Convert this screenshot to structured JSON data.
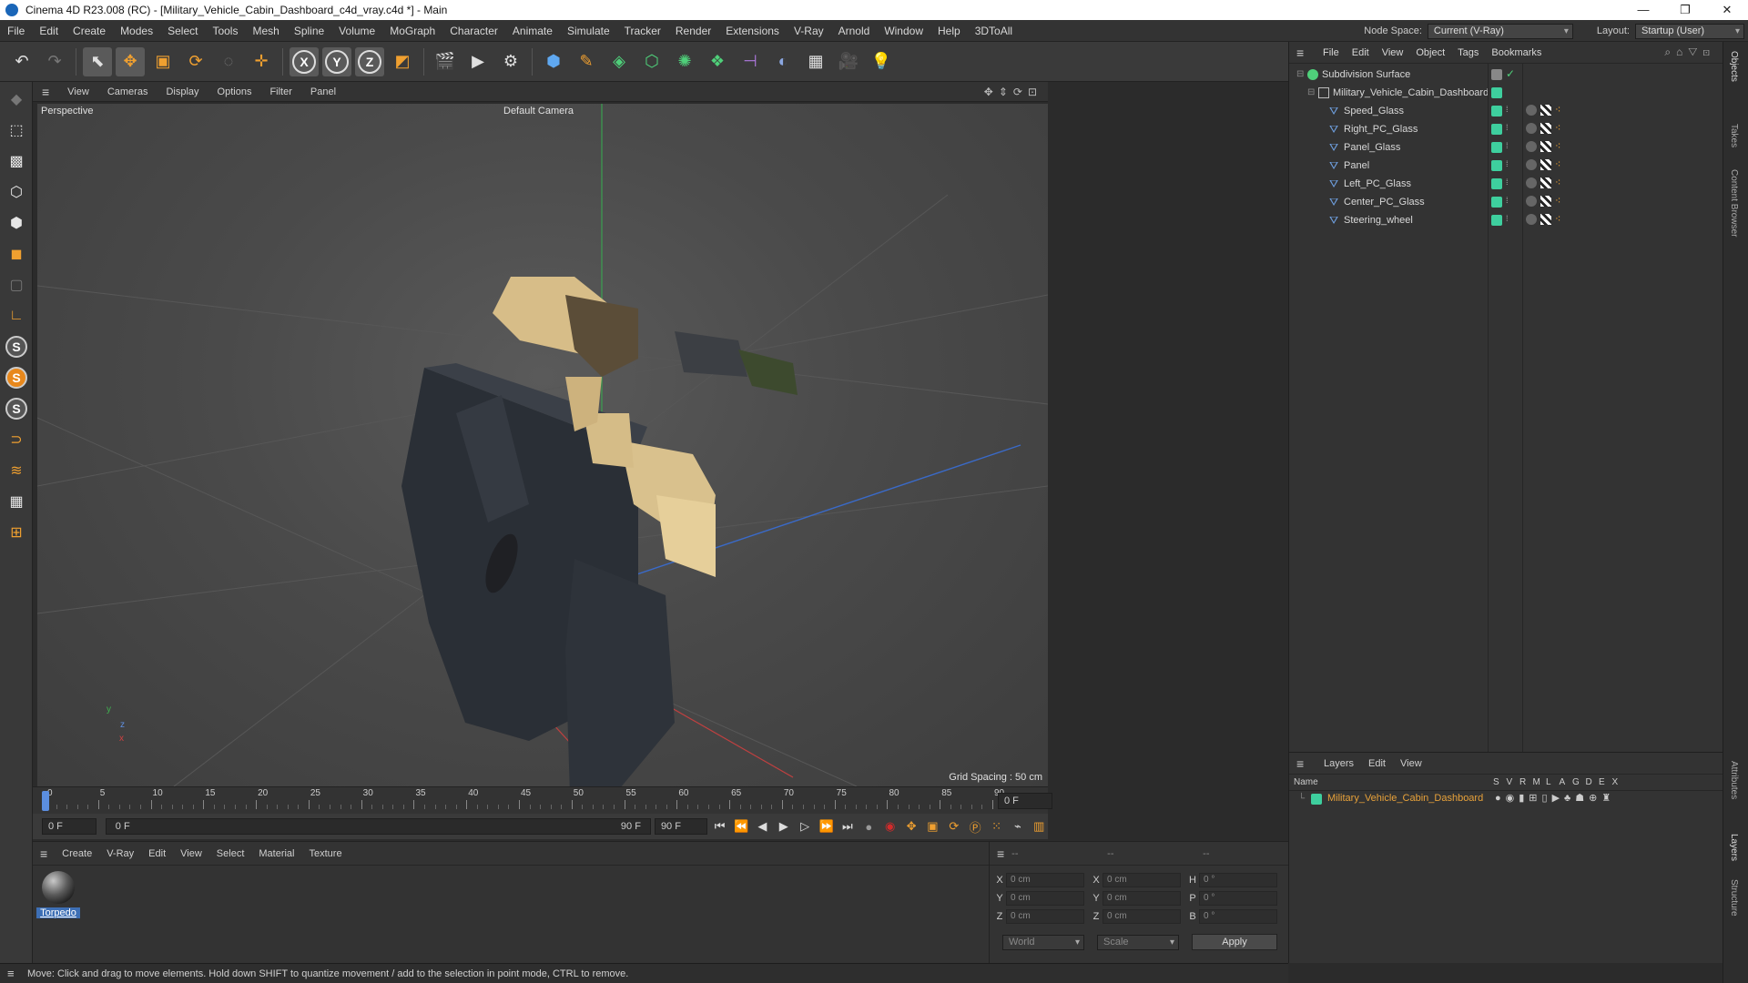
{
  "window": {
    "title": "Cinema 4D R23.008 (RC) - [Military_Vehicle_Cabin_Dashboard_c4d_vray.c4d *] - Main",
    "minimize": "—",
    "maximize": "❐",
    "close": "✕"
  },
  "menubar": {
    "items": [
      "File",
      "Edit",
      "Create",
      "Modes",
      "Select",
      "Tools",
      "Mesh",
      "Spline",
      "Volume",
      "MoGraph",
      "Character",
      "Animate",
      "Simulate",
      "Tracker",
      "Render",
      "Extensions",
      "V-Ray",
      "Arnold",
      "Window",
      "Help",
      "3DToAll"
    ],
    "node_space_label": "Node Space:",
    "node_space_value": "Current (V-Ray)",
    "layout_label": "Layout:",
    "layout_value": "Startup (User)"
  },
  "viewport": {
    "menu": [
      "View",
      "Cameras",
      "Display",
      "Options",
      "Filter",
      "Panel"
    ],
    "label": "Perspective",
    "camera": "Default Camera",
    "grid_spacing": "Grid Spacing : 50 cm"
  },
  "timeline": {
    "ticks": [
      "0",
      "5",
      "10",
      "15",
      "20",
      "25",
      "30",
      "35",
      "40",
      "45",
      "50",
      "55",
      "60",
      "65",
      "70",
      "75",
      "80",
      "85",
      "90"
    ],
    "current_frame": "0 F",
    "start": "0 F",
    "range_start": "0 F",
    "range_end": "90 F",
    "end": "90 F"
  },
  "materials": {
    "menu": [
      "Create",
      "V-Ray",
      "Edit",
      "View",
      "Select",
      "Material",
      "Texture"
    ],
    "items": [
      {
        "name": "Torpedo"
      }
    ]
  },
  "coordinates": {
    "headers": [
      "--",
      "--",
      "--"
    ],
    "rows": [
      {
        "a": "X",
        "av": "0 cm",
        "b": "X",
        "bv": "0 cm",
        "c": "H",
        "cv": "0 °"
      },
      {
        "a": "Y",
        "av": "0 cm",
        "b": "Y",
        "bv": "0 cm",
        "c": "P",
        "cv": "0 °"
      },
      {
        "a": "Z",
        "av": "0 cm",
        "b": "Z",
        "bv": "0 cm",
        "c": "B",
        "cv": "0 °"
      }
    ],
    "mode1": "World",
    "mode2": "Scale",
    "apply": "Apply"
  },
  "status": "Move: Click and drag to move elements. Hold down SHIFT to quantize movement / add to the selection in point mode, CTRL to remove.",
  "objects": {
    "menu": [
      "File",
      "Edit",
      "View",
      "Object",
      "Tags",
      "Bookmarks"
    ],
    "tree": [
      {
        "name": "Subdivision Surface",
        "level": 0
      },
      {
        "name": "Military_Vehicle_Cabin_Dashboard",
        "level": 1
      },
      {
        "name": "Speed_Glass",
        "level": 2
      },
      {
        "name": "Right_PC_Glass",
        "level": 2
      },
      {
        "name": "Panel_Glass",
        "level": 2
      },
      {
        "name": "Panel",
        "level": 2
      },
      {
        "name": "Left_PC_Glass",
        "level": 2
      },
      {
        "name": "Center_PC_Glass",
        "level": 2
      },
      {
        "name": "Steering_wheel",
        "level": 2
      }
    ]
  },
  "layers": {
    "menu": [
      "Layers",
      "Edit",
      "View"
    ],
    "header_name": "Name",
    "flags": [
      "S",
      "V",
      "R",
      "M",
      "L",
      "A",
      "G",
      "D",
      "E",
      "X"
    ],
    "items": [
      {
        "name": "Military_Vehicle_Cabin_Dashboard",
        "color": "#3ecf9e"
      }
    ]
  },
  "side_tabs": [
    "Objects",
    "Takes",
    "Content Browser",
    "Attributes",
    "Layers",
    "Structure"
  ],
  "colors": {
    "accent": "#3ecf9e",
    "selection": "#3d6fb5",
    "layer_name": "#e8a23a",
    "record": "#d22b2b"
  }
}
